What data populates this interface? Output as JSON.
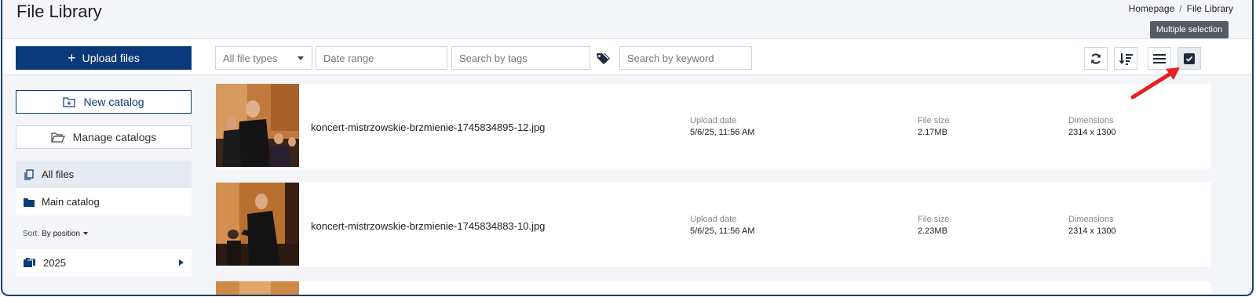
{
  "header": {
    "title": "File Library",
    "breadcrumb": [
      "Homepage",
      "File Library"
    ]
  },
  "toolbar": {
    "upload_label": "Upload files",
    "file_type_select": "All file types",
    "date_range_placeholder": "Date range",
    "tags_placeholder": "Search by tags",
    "keyword_placeholder": "Search by keyword",
    "tooltip": "Multiple selection",
    "tools": [
      "refresh-icon",
      "sort-icon",
      "list-view-icon",
      "multi-select-icon"
    ]
  },
  "sidebar": {
    "new_catalog": "New catalog",
    "manage_catalogs": "Manage catalogs",
    "items": [
      {
        "label": "All files"
      },
      {
        "label": "Main catalog"
      }
    ],
    "sort_label": "Sort:",
    "sort_value": "By position",
    "folders": [
      {
        "label": "2025"
      }
    ]
  },
  "files": [
    {
      "name": "koncert-mistrzowskie-brzmienie-1745834895-12.jpg",
      "upload_label": "Upload date",
      "upload_date": "5/6/25, 11:56 AM",
      "size_label": "File size",
      "size": "2.17MB",
      "dims_label": "Dimensions",
      "dims": "2314 x 1300"
    },
    {
      "name": "koncert-mistrzowskie-brzmienie-1745834883-10.jpg",
      "upload_label": "Upload date",
      "upload_date": "5/6/25, 11:56 AM",
      "size_label": "File size",
      "size": "2.23MB",
      "dims_label": "Dimensions",
      "dims": "2314 x 1300"
    }
  ],
  "colors": {
    "primary": "#0a3a7a",
    "annotation_arrow": "#e8201e"
  }
}
